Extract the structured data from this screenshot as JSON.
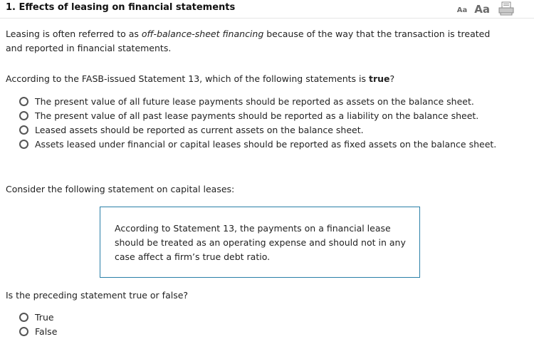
{
  "header": {
    "title": "1. Effects of leasing on financial statements",
    "font_small_label": "Aa",
    "font_large_label": "Aa"
  },
  "intro": {
    "prefix": "Leasing is often referred to as ",
    "emphasis": "off-balance-sheet financing",
    "suffix": " because of the way that the transaction is treated and reported in financial statements."
  },
  "question1": {
    "prefix": "According to the FASB-issued Statement 13, which of the following statements is ",
    "bold": "true",
    "suffix": "?",
    "options": [
      "The present value of all future lease payments should be reported as assets on the balance sheet.",
      "The present value of all past lease payments should be reported as a liability on the balance sheet.",
      "Leased assets should be reported as current assets on the balance sheet.",
      "Assets leased under financial or capital leases should be reported as fixed assets on the balance sheet."
    ]
  },
  "consider": "Consider the following statement on capital leases:",
  "quote": "According to Statement 13, the payments on a financial lease should be treated as an operating expense and should not in any case affect a firm’s true debt ratio.",
  "question2": {
    "text": "Is the preceding statement true or false?",
    "options": [
      "True",
      "False"
    ]
  },
  "colors": {
    "quote_border": "#2a7fa7",
    "radio_border": "#555555",
    "tool_gray": "#6b6b6b"
  },
  "icons": {
    "print": "print-icon"
  }
}
